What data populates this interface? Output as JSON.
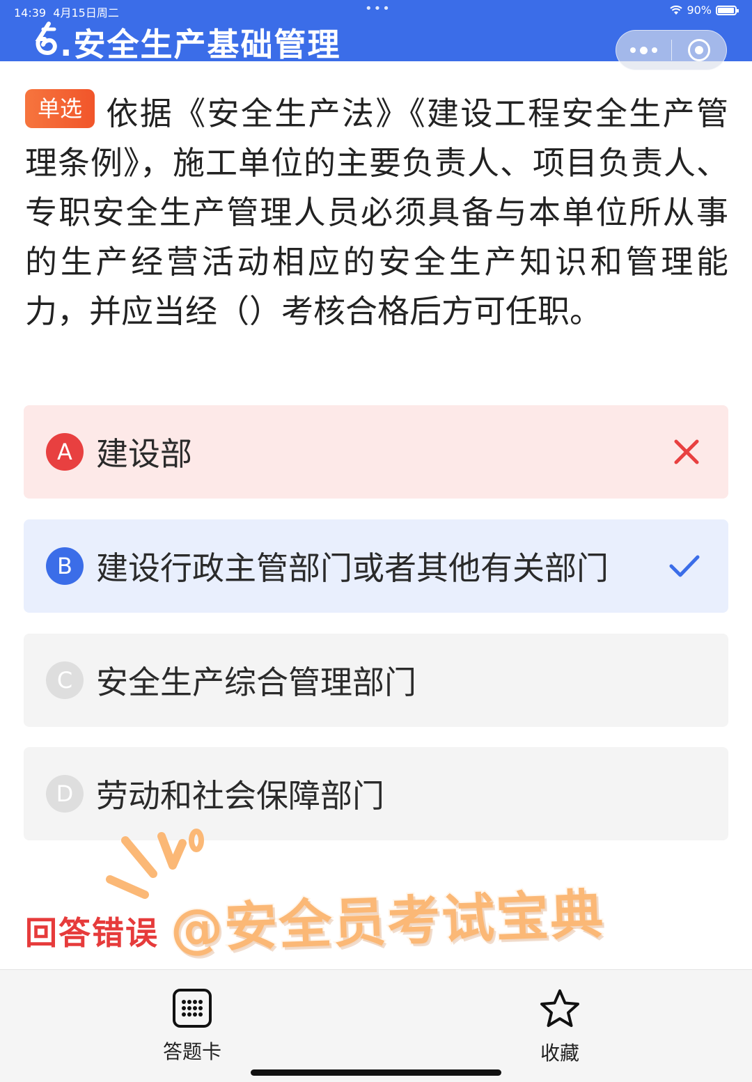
{
  "status_bar": {
    "time": "14:39",
    "date": "4月15日周二",
    "battery": "90%",
    "battery_level": 0.9
  },
  "header": {
    "title": ".安全生产基础管理",
    "bg_color": "#3b6de8"
  },
  "question": {
    "type_badge": "单选",
    "text": "依据《安全生产法》《建设工程安全生产管理条例》，施工单位的主要负责人、项目负责人、专职安全生产管理人员必须具备与本单位所从事的生产经营活动相应的安全生产知识和管理能力，并应当经（）考核合格后方可任职。"
  },
  "options": [
    {
      "letter": "A",
      "text": "建设部",
      "state": "wrong",
      "mark_icon": "close-icon"
    },
    {
      "letter": "B",
      "text": "建设行政主管部门或者其他有关部门",
      "state": "correct",
      "mark_icon": "check-icon"
    },
    {
      "letter": "C",
      "text": "安全生产综合管理部门",
      "state": "neutral"
    },
    {
      "letter": "D",
      "text": "劳动和社会保障部门",
      "state": "neutral"
    }
  ],
  "feedback": {
    "result": "回答错误",
    "watermark": "@安全员考试宝典",
    "result_color": "#e63b3b"
  },
  "bottom_bar": {
    "answer_card_label": "答题卡",
    "answer_card_icon": "grid-icon",
    "favorite_label": "收藏",
    "favorite_icon": "star-icon"
  }
}
